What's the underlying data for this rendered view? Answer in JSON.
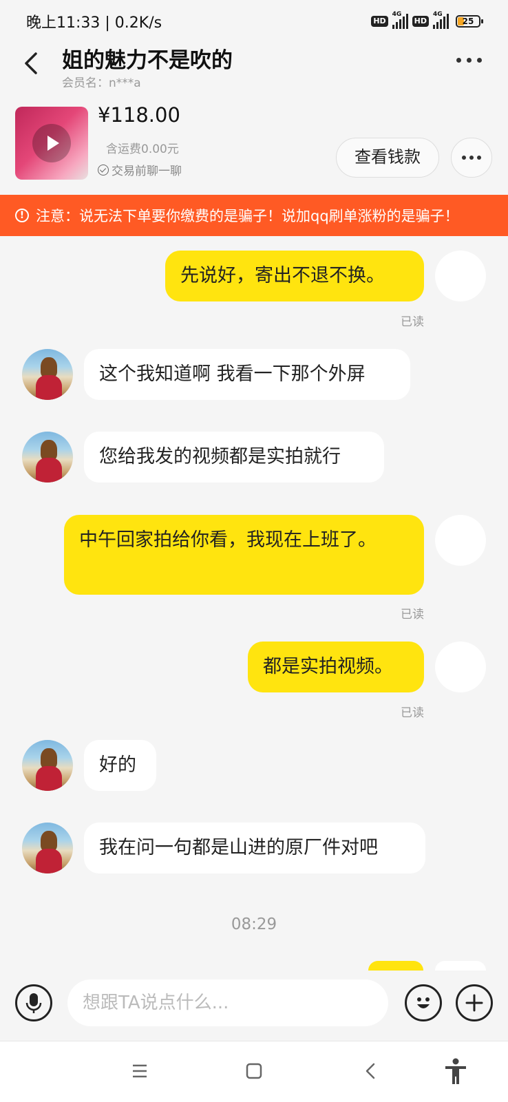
{
  "status_bar": {
    "time": "晚上11:33 | 0.2K/s",
    "hd": "HD",
    "network": "4G",
    "battery": "25"
  },
  "header": {
    "title": "姐的魅力不是吹的",
    "member": "会员名：n***a"
  },
  "product": {
    "price": "¥118.00",
    "shipping": "含运费0.00元",
    "chat_first": "交易前聊一聊",
    "view_button": "查看钱款"
  },
  "warning": {
    "icon": "!",
    "text": "注意：说无法下单要你缴费的是骗子！说加qq刷单涨粉的是骗子！"
  },
  "messages": [
    {
      "from": "me",
      "text": "先说好，寄出不退不换。",
      "status": "已读"
    },
    {
      "from": "them",
      "text": "这个我知道啊 我看一下那个外屏"
    },
    {
      "from": "them",
      "text": "您给我发的视频都是实拍就行"
    },
    {
      "from": "me",
      "text": "中午回家拍给你看，我现在上班了。",
      "status": "已读"
    },
    {
      "from": "me",
      "text": "都是实拍视频。",
      "status": "已读"
    },
    {
      "from": "them",
      "text": "好的"
    },
    {
      "from": "them",
      "text": "我在问一句都是山进的原厂件对吧"
    }
  ],
  "timestamp": "08:29",
  "composer": {
    "placeholder": "想跟TA说点什么..."
  },
  "colors": {
    "accent": "#ffe40f",
    "warning": "#ff5a24"
  }
}
